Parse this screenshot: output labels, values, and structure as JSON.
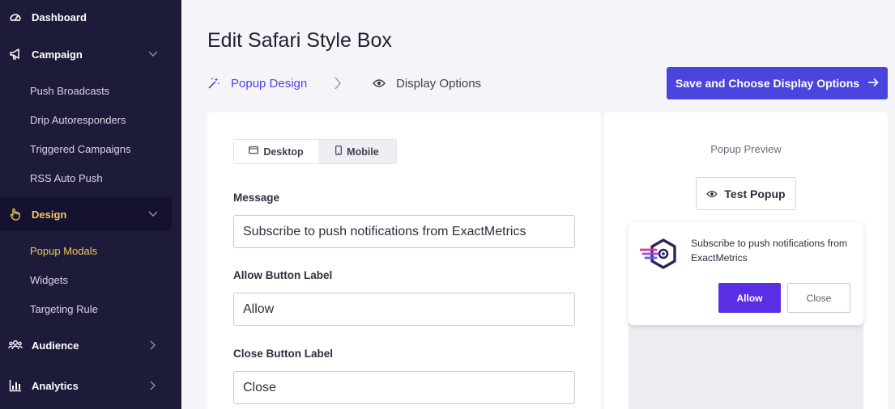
{
  "sidebar": {
    "items": [
      {
        "label": "Dashboard",
        "icon": "dashboard-icon"
      },
      {
        "label": "Campaign",
        "icon": "megaphone-icon",
        "chevron": "chevron-down-icon"
      },
      {
        "label": "Design",
        "icon": "pointer-hand-icon",
        "chevron": "chevron-down-icon",
        "active": true
      },
      {
        "label": "Audience",
        "icon": "users-icon",
        "chevron": "chevron-right-icon"
      },
      {
        "label": "Analytics",
        "icon": "bar-chart-icon",
        "chevron": "chevron-right-icon"
      }
    ],
    "campaign_sub": [
      "Push Broadcasts",
      "Drip Autoresponders",
      "Triggered Campaigns",
      "RSS Auto Push"
    ],
    "design_sub": [
      "Popup Modals",
      "Widgets",
      "Targeting Rule"
    ],
    "active_sub": "Popup Modals"
  },
  "header": {
    "title": "Edit Safari Style Box",
    "steps": [
      {
        "label": "Popup Design",
        "icon": "magic-wand-icon",
        "active": true
      },
      {
        "label": "Display Options",
        "icon": "eye-icon",
        "active": false
      }
    ],
    "save_label": "Save and Choose Display Options"
  },
  "editor": {
    "device_toggle": {
      "desktop": "Desktop",
      "mobile": "Mobile",
      "selected": "Mobile"
    },
    "fields": [
      {
        "label": "Message",
        "value": "Subscribe to push notifications from ExactMetrics"
      },
      {
        "label": "Allow Button Label",
        "value": "Allow"
      },
      {
        "label": "Close Button Label",
        "value": "Close"
      }
    ]
  },
  "preview": {
    "title": "Popup Preview",
    "test_label": "Test Popup",
    "message": "Subscribe to push notifications from ExactMetrics",
    "allow_label": "Allow",
    "close_label": "Close"
  },
  "colors": {
    "sidebar_bg": "#1d1b3a",
    "accent": "#4b45e0",
    "active_yellow": "#f7c55e",
    "allow_purple": "#5a2ee5"
  }
}
